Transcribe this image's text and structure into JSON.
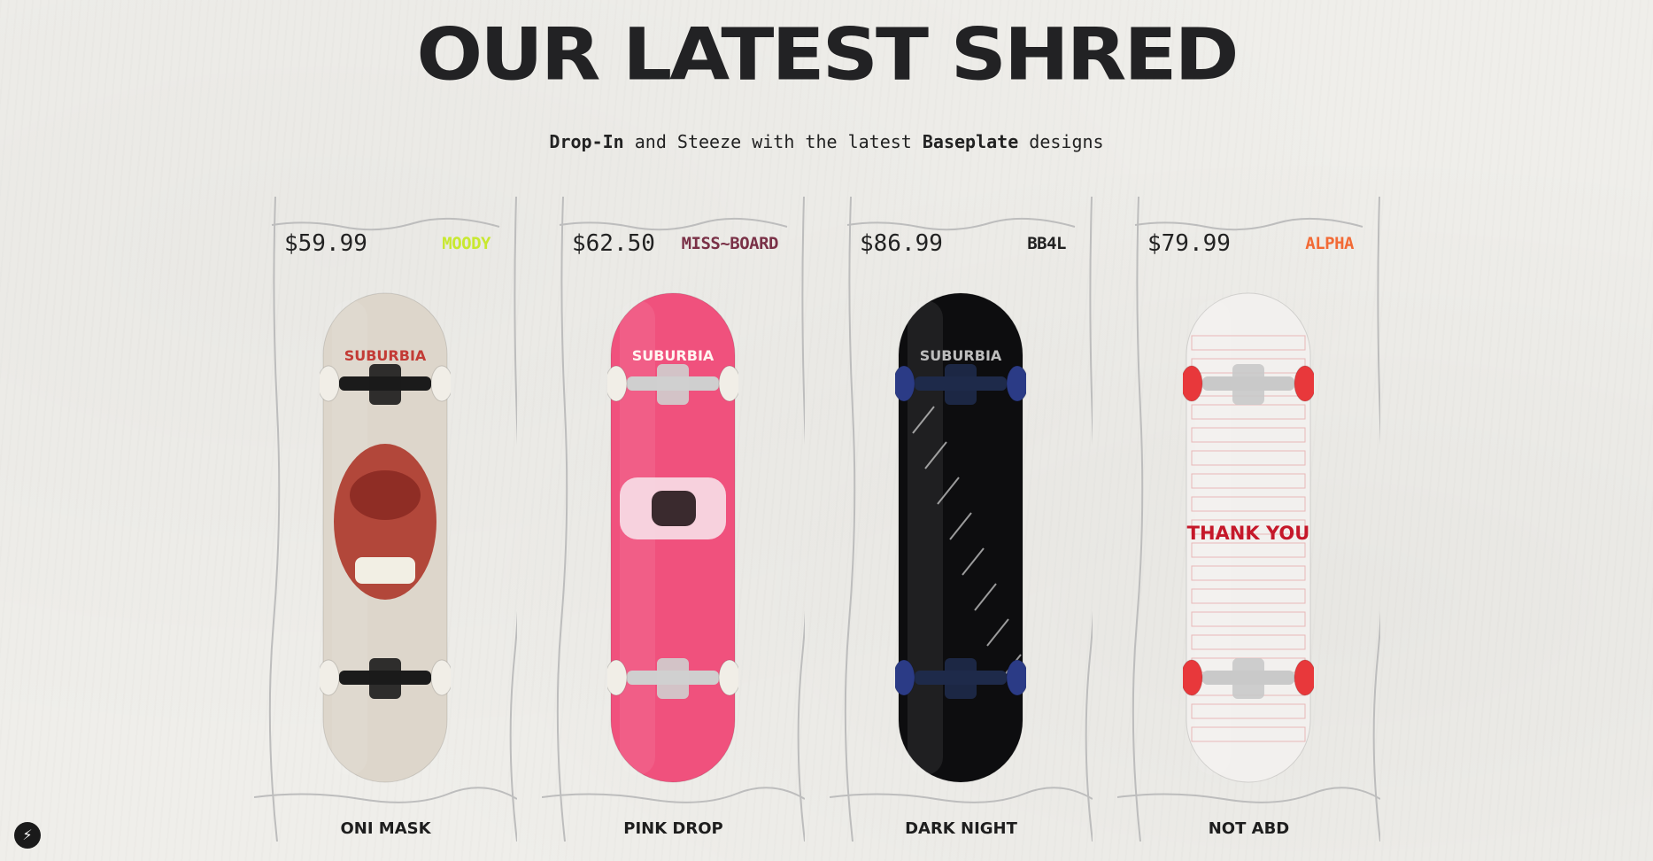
{
  "header": {
    "title": "OUR LATEST SHRED",
    "subtitle_part1": "Drop-In",
    "subtitle_part2": " and Steeze with the latest ",
    "subtitle_part3": "Baseplate",
    "subtitle_part4": " designs"
  },
  "products": [
    {
      "price": "$59.99",
      "brand": "MOODY",
      "brand_color": "#c8e830",
      "name": "ONI MASK",
      "deck_color": "#ddd6cb",
      "wheel_color": "#f1eee7",
      "truck_color": "#1b1b1b",
      "deck_text": "SUBURBIA"
    },
    {
      "price": "$62.50",
      "brand": "MISS~BOARD",
      "brand_color": "#7a3147",
      "name": "PINK DROP",
      "deck_color": "#f0517d",
      "wheel_color": "#f1eee7",
      "truck_color": "#cfcfcf",
      "deck_text": "SUBURBIA"
    },
    {
      "price": "$86.99",
      "brand": "BB4L",
      "brand_color": "#222222",
      "name": "DARK NIGHT",
      "deck_color": "#0d0d0f",
      "wheel_color": "#2b3b86",
      "truck_color": "#1e2a4a",
      "deck_text": "SUBURBIA"
    },
    {
      "price": "$79.99",
      "brand": "ALPHA",
      "brand_color": "#f26a35",
      "name": "NOT ABD",
      "deck_color": "#f2f0ee",
      "wheel_color": "#e8383b",
      "truck_color": "#c9c9c9",
      "deck_text": "THANK YOU"
    }
  ],
  "widget": {
    "icon": "lightning-icon"
  }
}
